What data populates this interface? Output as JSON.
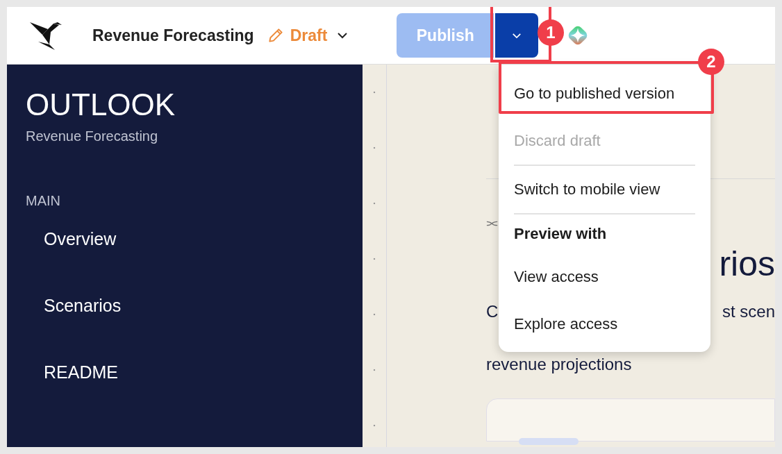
{
  "header": {
    "title": "Revenue Forecasting",
    "status": "Draft",
    "publish_button": {
      "label": "Publish",
      "disabled": true
    }
  },
  "sidebar": {
    "title": "OUTLOOK",
    "subtitle": "Revenue Forecasting",
    "section": "MAIN",
    "items": [
      {
        "label": "Overview"
      },
      {
        "label": "Scenarios"
      },
      {
        "label": "README"
      }
    ]
  },
  "page": {
    "heading_fragments": [
      "rios"
    ],
    "description_fragments": [
      "C",
      "st scen"
    ],
    "description_line_2": "revenue projections"
  },
  "menu": {
    "items": [
      {
        "kind": "item",
        "label": "Go to published version",
        "disabled": false
      },
      {
        "kind": "item",
        "label": "Discard draft",
        "disabled": true
      },
      {
        "kind": "divider"
      },
      {
        "kind": "item",
        "label": "Switch to mobile view",
        "disabled": false
      },
      {
        "kind": "divider"
      },
      {
        "kind": "header",
        "label": "Preview with"
      },
      {
        "kind": "item",
        "label": "View access",
        "disabled": false
      },
      {
        "kind": "item",
        "label": "Explore access",
        "disabled": false
      }
    ]
  },
  "annotations": [
    {
      "label": "1"
    },
    {
      "label": "2"
    }
  ]
}
